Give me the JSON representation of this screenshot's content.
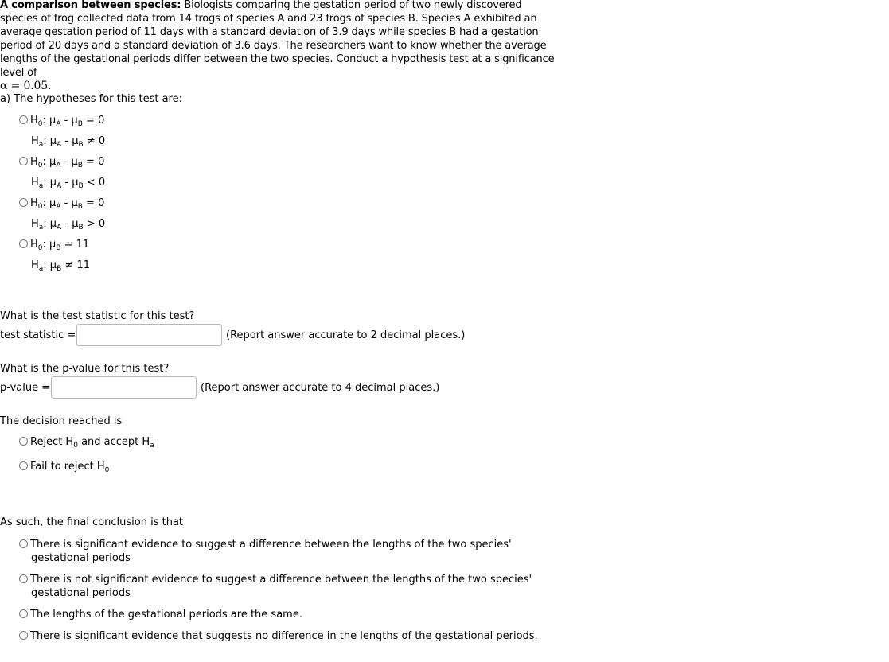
{
  "problem": {
    "title": "A comparison between species:",
    "body": "Biologists comparing the gestation period of two newly discovered species of frog collected data from 14 frogs of species A and 23 frogs of species B. Species A exhibited an average gestation period of 11 days with a standard deviation of 3.9 days while species B had a gestation period of 20 days and a standard deviation of 3.6 days. The researchers want to know whether the average lengths of the gestational periods differ between the two species. Conduct a hypothesis test at a significance level of",
    "alpha": "α = 0.05."
  },
  "hypotheses": {
    "prompt": "a) The hypotheses for this test are:",
    "options": [
      {
        "h0_prefix": "H",
        "h0_sub": "0",
        "h0_text": ": μ",
        "h0_mu1": "A",
        "h0_mid": " - μ",
        "h0_mu2": "B",
        "h0_rel": " = 0",
        "ha_prefix": "H",
        "ha_sub": "a",
        "ha_text": ": μ",
        "ha_mu1": "A",
        "ha_mid": " - μ",
        "ha_mu2": "B",
        "ha_rel": " ≠ 0"
      },
      {
        "h0_prefix": "H",
        "h0_sub": "0",
        "h0_text": ": μ",
        "h0_mu1": "A",
        "h0_mid": " - μ",
        "h0_mu2": "B",
        "h0_rel": " = 0",
        "ha_prefix": "H",
        "ha_sub": "a",
        "ha_text": ": μ",
        "ha_mu1": "A",
        "ha_mid": " - μ",
        "ha_mu2": "B",
        "ha_rel": " < 0"
      },
      {
        "h0_prefix": "H",
        "h0_sub": "0",
        "h0_text": ": μ",
        "h0_mu1": "A",
        "h0_mid": " - μ",
        "h0_mu2": "B",
        "h0_rel": " = 0",
        "ha_prefix": "H",
        "ha_sub": "a",
        "ha_text": ": μ",
        "ha_mu1": "A",
        "ha_mid": " - μ",
        "ha_mu2": "B",
        "ha_rel": " > 0"
      },
      {
        "h0_prefix": "H",
        "h0_sub": "0",
        "h0_text": ": μ",
        "h0_mu2": "B",
        "h0_rel": " = 11",
        "ha_prefix": "H",
        "ha_sub": "a",
        "ha_text": ": μ",
        "ha_mu2": "B",
        "ha_rel": " ≠ 11"
      }
    ]
  },
  "test_statistic": {
    "question": "What is the test statistic for this test?",
    "label": "test statistic =",
    "value": "",
    "hint": "(Report answer accurate to 2 decimal places.)"
  },
  "p_value": {
    "question": "What is the p-value for this test?",
    "label": "p-value =",
    "value": "",
    "hint": "(Report answer accurate to 4 decimal places.)"
  },
  "decision": {
    "prompt": "The decision reached is",
    "options": [
      {
        "a": "Reject H",
        "a_sub": "0",
        "b": " and accept H",
        "b_sub": "a"
      },
      {
        "a": "Fail to reject H",
        "a_sub": "0"
      }
    ]
  },
  "conclusion": {
    "prompt": "As such, the final conclusion is that",
    "options": [
      {
        "line1": "There is significant evidence to suggest a difference between the lengths of the two species'",
        "line2": "gestational periods"
      },
      {
        "line1": "There is not significant evidence to suggest a difference between the lengths of the two species'",
        "line2": "gestational periods"
      },
      {
        "line1": "The lengths of the gestational periods are the same."
      },
      {
        "line1": "There is significant evidence that suggests no difference in the lengths of the gestational periods."
      }
    ]
  }
}
